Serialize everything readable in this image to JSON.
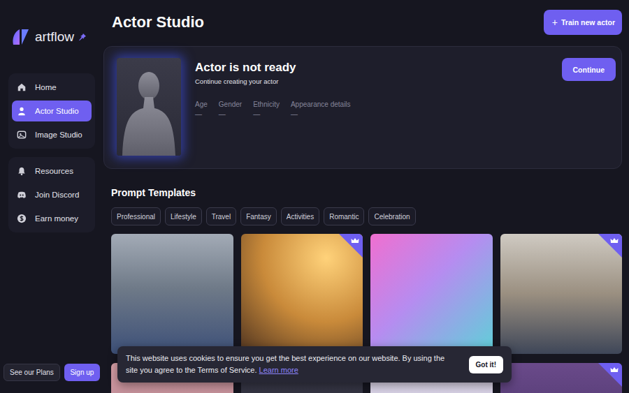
{
  "logo": {
    "text": "artflow"
  },
  "sidebar": {
    "groups": [
      [
        {
          "label": "Home",
          "selected": false
        },
        {
          "label": "Actor Studio",
          "selected": true
        },
        {
          "label": "Image Studio",
          "selected": false
        }
      ],
      [
        {
          "label": "Resources",
          "selected": false
        },
        {
          "label": "Join Discord",
          "selected": false
        },
        {
          "label": "Earn money",
          "selected": false
        }
      ]
    ],
    "plans_button": "See our Plans",
    "signup_button": "Sign up"
  },
  "header": {
    "title": "Actor Studio",
    "action_icon": "+",
    "action": "Train new actor"
  },
  "actor": {
    "title": "Actor is not ready",
    "subtitle": "Continue creating your actor",
    "fields": [
      {
        "label": "Age",
        "value": "—"
      },
      {
        "label": "Gender",
        "value": "—"
      },
      {
        "label": "Ethnicity",
        "value": "—"
      },
      {
        "label": "Appearance details",
        "value": "—"
      }
    ],
    "button": "Continue"
  },
  "templates": {
    "title": "Prompt Templates",
    "categories": [
      {
        "label": "Professional",
        "selected": false
      },
      {
        "label": "Lifestyle",
        "selected": false
      },
      {
        "label": "Travel",
        "selected": false
      },
      {
        "label": "Fantasy",
        "selected": false
      },
      {
        "label": "Activities",
        "selected": false
      },
      {
        "label": "Romantic",
        "selected": false
      },
      {
        "label": "Celebration",
        "selected": false
      }
    ],
    "cards": [
      {
        "premium": false
      },
      {
        "premium": true
      },
      {
        "premium": false
      },
      {
        "premium": true
      },
      {
        "premium": false
      },
      {
        "premium": false
      },
      {
        "premium": false
      },
      {
        "premium": true
      }
    ]
  },
  "cookie": {
    "text": "This website uses cookies to ensure you get the best experience on our website. By using the site you agree to the Terms of Service.",
    "link": "Learn more",
    "button": "Got it!"
  }
}
